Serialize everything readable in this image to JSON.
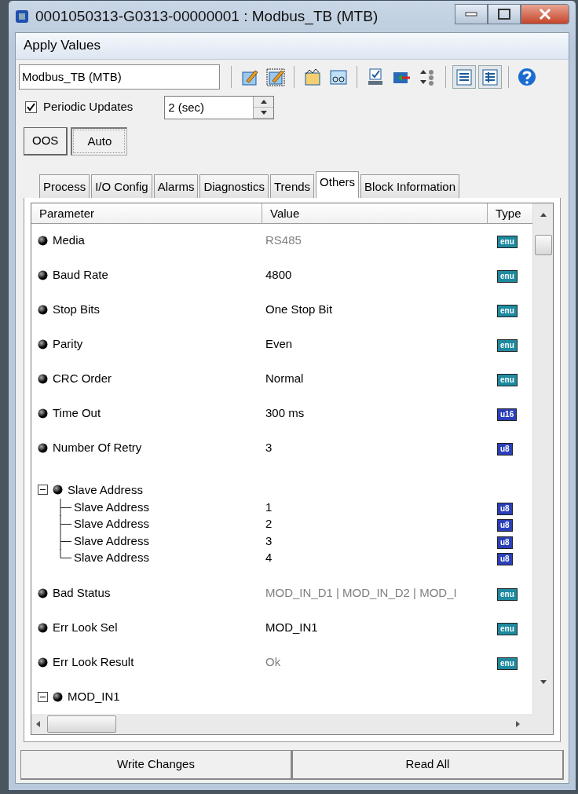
{
  "window": {
    "title": "0001050313-G0313-00000001 : Modbus_TB (MTB)"
  },
  "menu": {
    "label": "Apply Values"
  },
  "toolbar": {
    "block_field": "Modbus_TB (MTB)",
    "groups": [
      [
        {
          "kind": "edit",
          "pressed": false
        },
        {
          "kind": "edit-dotted",
          "pressed": false
        }
      ],
      [
        {
          "kind": "chart",
          "pressed": false
        },
        {
          "kind": "glasses",
          "pressed": false
        }
      ],
      [
        {
          "kind": "monitor",
          "pressed": false
        },
        {
          "kind": "folder-arrow",
          "pressed": false
        },
        {
          "kind": "nodes",
          "pressed": false
        }
      ],
      [
        {
          "kind": "list",
          "pressed": true
        },
        {
          "kind": "table",
          "pressed": true
        }
      ],
      [
        {
          "kind": "help",
          "pressed": false
        }
      ]
    ]
  },
  "periodic": {
    "label": "Periodic Updates",
    "checked": true,
    "interval": "2 (sec)"
  },
  "modes": [
    {
      "label": "OOS",
      "selected": false
    },
    {
      "label": "Auto",
      "selected": true
    }
  ],
  "tabs": [
    {
      "label": "Process",
      "selected": false
    },
    {
      "label": "I/O Config",
      "selected": false
    },
    {
      "label": "Alarms",
      "selected": false
    },
    {
      "label": "Diagnostics",
      "selected": false
    },
    {
      "label": "Trends",
      "selected": false
    },
    {
      "label": "Others",
      "selected": true
    },
    {
      "label": "Block Information",
      "selected": false
    }
  ],
  "table": {
    "columns": [
      "Parameter",
      "Value",
      "Type"
    ],
    "rows": [
      {
        "parameter": "Media",
        "value": "RS485",
        "read_only": true,
        "type": "enu",
        "kind": "enum"
      },
      {
        "parameter": "Baud Rate",
        "value": "4800",
        "read_only": false,
        "type": "enu",
        "kind": "enum"
      },
      {
        "parameter": "Stop Bits",
        "value": "One Stop Bit",
        "read_only": false,
        "type": "enu",
        "kind": "enum"
      },
      {
        "parameter": "Parity",
        "value": "Even",
        "read_only": false,
        "type": "enu",
        "kind": "enum"
      },
      {
        "parameter": "CRC Order",
        "value": "Normal",
        "read_only": false,
        "type": "enu",
        "kind": "enum"
      },
      {
        "parameter": "Time Out",
        "value": "300 ms",
        "read_only": false,
        "type": "u16",
        "kind": "int"
      },
      {
        "parameter": "Number Of Retry",
        "value": "3",
        "read_only": false,
        "type": "u8",
        "kind": "int"
      },
      {
        "parameter": "Slave Address",
        "expanded": true,
        "children": [
          {
            "parameter": "Slave Address",
            "value": "1",
            "read_only": false,
            "type": "u8",
            "kind": "int"
          },
          {
            "parameter": "Slave Address",
            "value": "2",
            "read_only": false,
            "type": "u8",
            "kind": "int"
          },
          {
            "parameter": "Slave Address",
            "value": "3",
            "read_only": false,
            "type": "u8",
            "kind": "int"
          },
          {
            "parameter": "Slave Address",
            "value": "4",
            "read_only": false,
            "type": "u8",
            "kind": "int"
          }
        ]
      },
      {
        "parameter": "Bad Status",
        "value": "MOD_IN_D1 | MOD_IN_D2 | MOD_I",
        "read_only": true,
        "type": "enu",
        "kind": "enum"
      },
      {
        "parameter": "Err Look Sel",
        "value": "MOD_IN1",
        "read_only": false,
        "type": "enu",
        "kind": "enum"
      },
      {
        "parameter": "Err Look Result",
        "value": "Ok",
        "read_only": true,
        "type": "enu",
        "kind": "enum"
      },
      {
        "parameter": "MOD_IN1",
        "expanded": true
      }
    ]
  },
  "buttons": [
    "Write Changes",
    "Read All"
  ]
}
